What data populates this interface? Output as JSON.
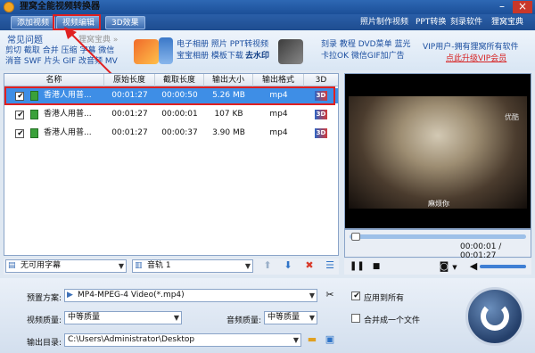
{
  "app": {
    "title": "狸窝全能视频转换器"
  },
  "menubar": {
    "tabs": [
      "添加视频",
      "视频编辑",
      "3D效果"
    ],
    "right_items": [
      "照片制作视频",
      "PPT转换",
      "刻录软件",
      "狸窝宝典"
    ]
  },
  "ad_area": {
    "faq_title": "常见问题",
    "faq_selector": "狸窝宝典",
    "faq_lines": [
      "剪切 截取 合并 压缩 字幕 微信",
      "消音 SWF 片头 GIF 改音频 MV"
    ],
    "group1_line1": "电子相册 照片 PPT转视频",
    "group1_line2": "宝宝相册 模板下载",
    "group1_line2_bold": "去水印",
    "group2_line1": "刻录 教程 DVD菜单 蓝光",
    "group2_line2": "卡拉OK 微信GIF加广告",
    "vip_text": "VIP用户-拥有狸窝所有软件",
    "vip_upgrade": "点此升级VIP会员"
  },
  "table": {
    "headers": [
      "名称",
      "原始长度",
      "截取长度",
      "输出大小",
      "输出格式",
      "3D"
    ],
    "rows": [
      {
        "name": "香港人用普...",
        "original": "00:01:27",
        "cut": "00:00:50",
        "size": "5.26 MB",
        "format": "mp4",
        "checked": true,
        "selected": true
      },
      {
        "name": "香港人用普...",
        "original": "00:01:27",
        "cut": "00:00:01",
        "size": "107 KB",
        "format": "mp4",
        "checked": true,
        "selected": false
      },
      {
        "name": "香港人用普...",
        "original": "00:01:27",
        "cut": "00:00:37",
        "size": "3.90 MB",
        "format": "mp4",
        "checked": true,
        "selected": false
      }
    ],
    "icon_3d": "3D"
  },
  "preview": {
    "watermark": "优酷",
    "caption": "麻烦你",
    "time": "00:00:01 / 00:01:27",
    "progress": 0.012
  },
  "list_toolbar": {
    "subtitle": "无可用字幕",
    "audio_track": "音轨 1"
  },
  "settings": {
    "preset_label": "预置方案:",
    "preset_value": "MP4-MPEG-4 Video(*.mp4)",
    "apply_all": "应用到所有",
    "video_quality_label": "视频质量:",
    "video_quality_value": "中等质量",
    "audio_quality_label": "音频质量:",
    "audio_quality_value": "中等质量",
    "merge_label": "合并成一个文件",
    "output_label": "输出目录:",
    "output_value": "C:\\Users\\Administrator\\Desktop"
  },
  "colors": {
    "titlebar": "#1b4f98",
    "selected_row": "#3e8ee6",
    "annotation": "#e02020"
  }
}
